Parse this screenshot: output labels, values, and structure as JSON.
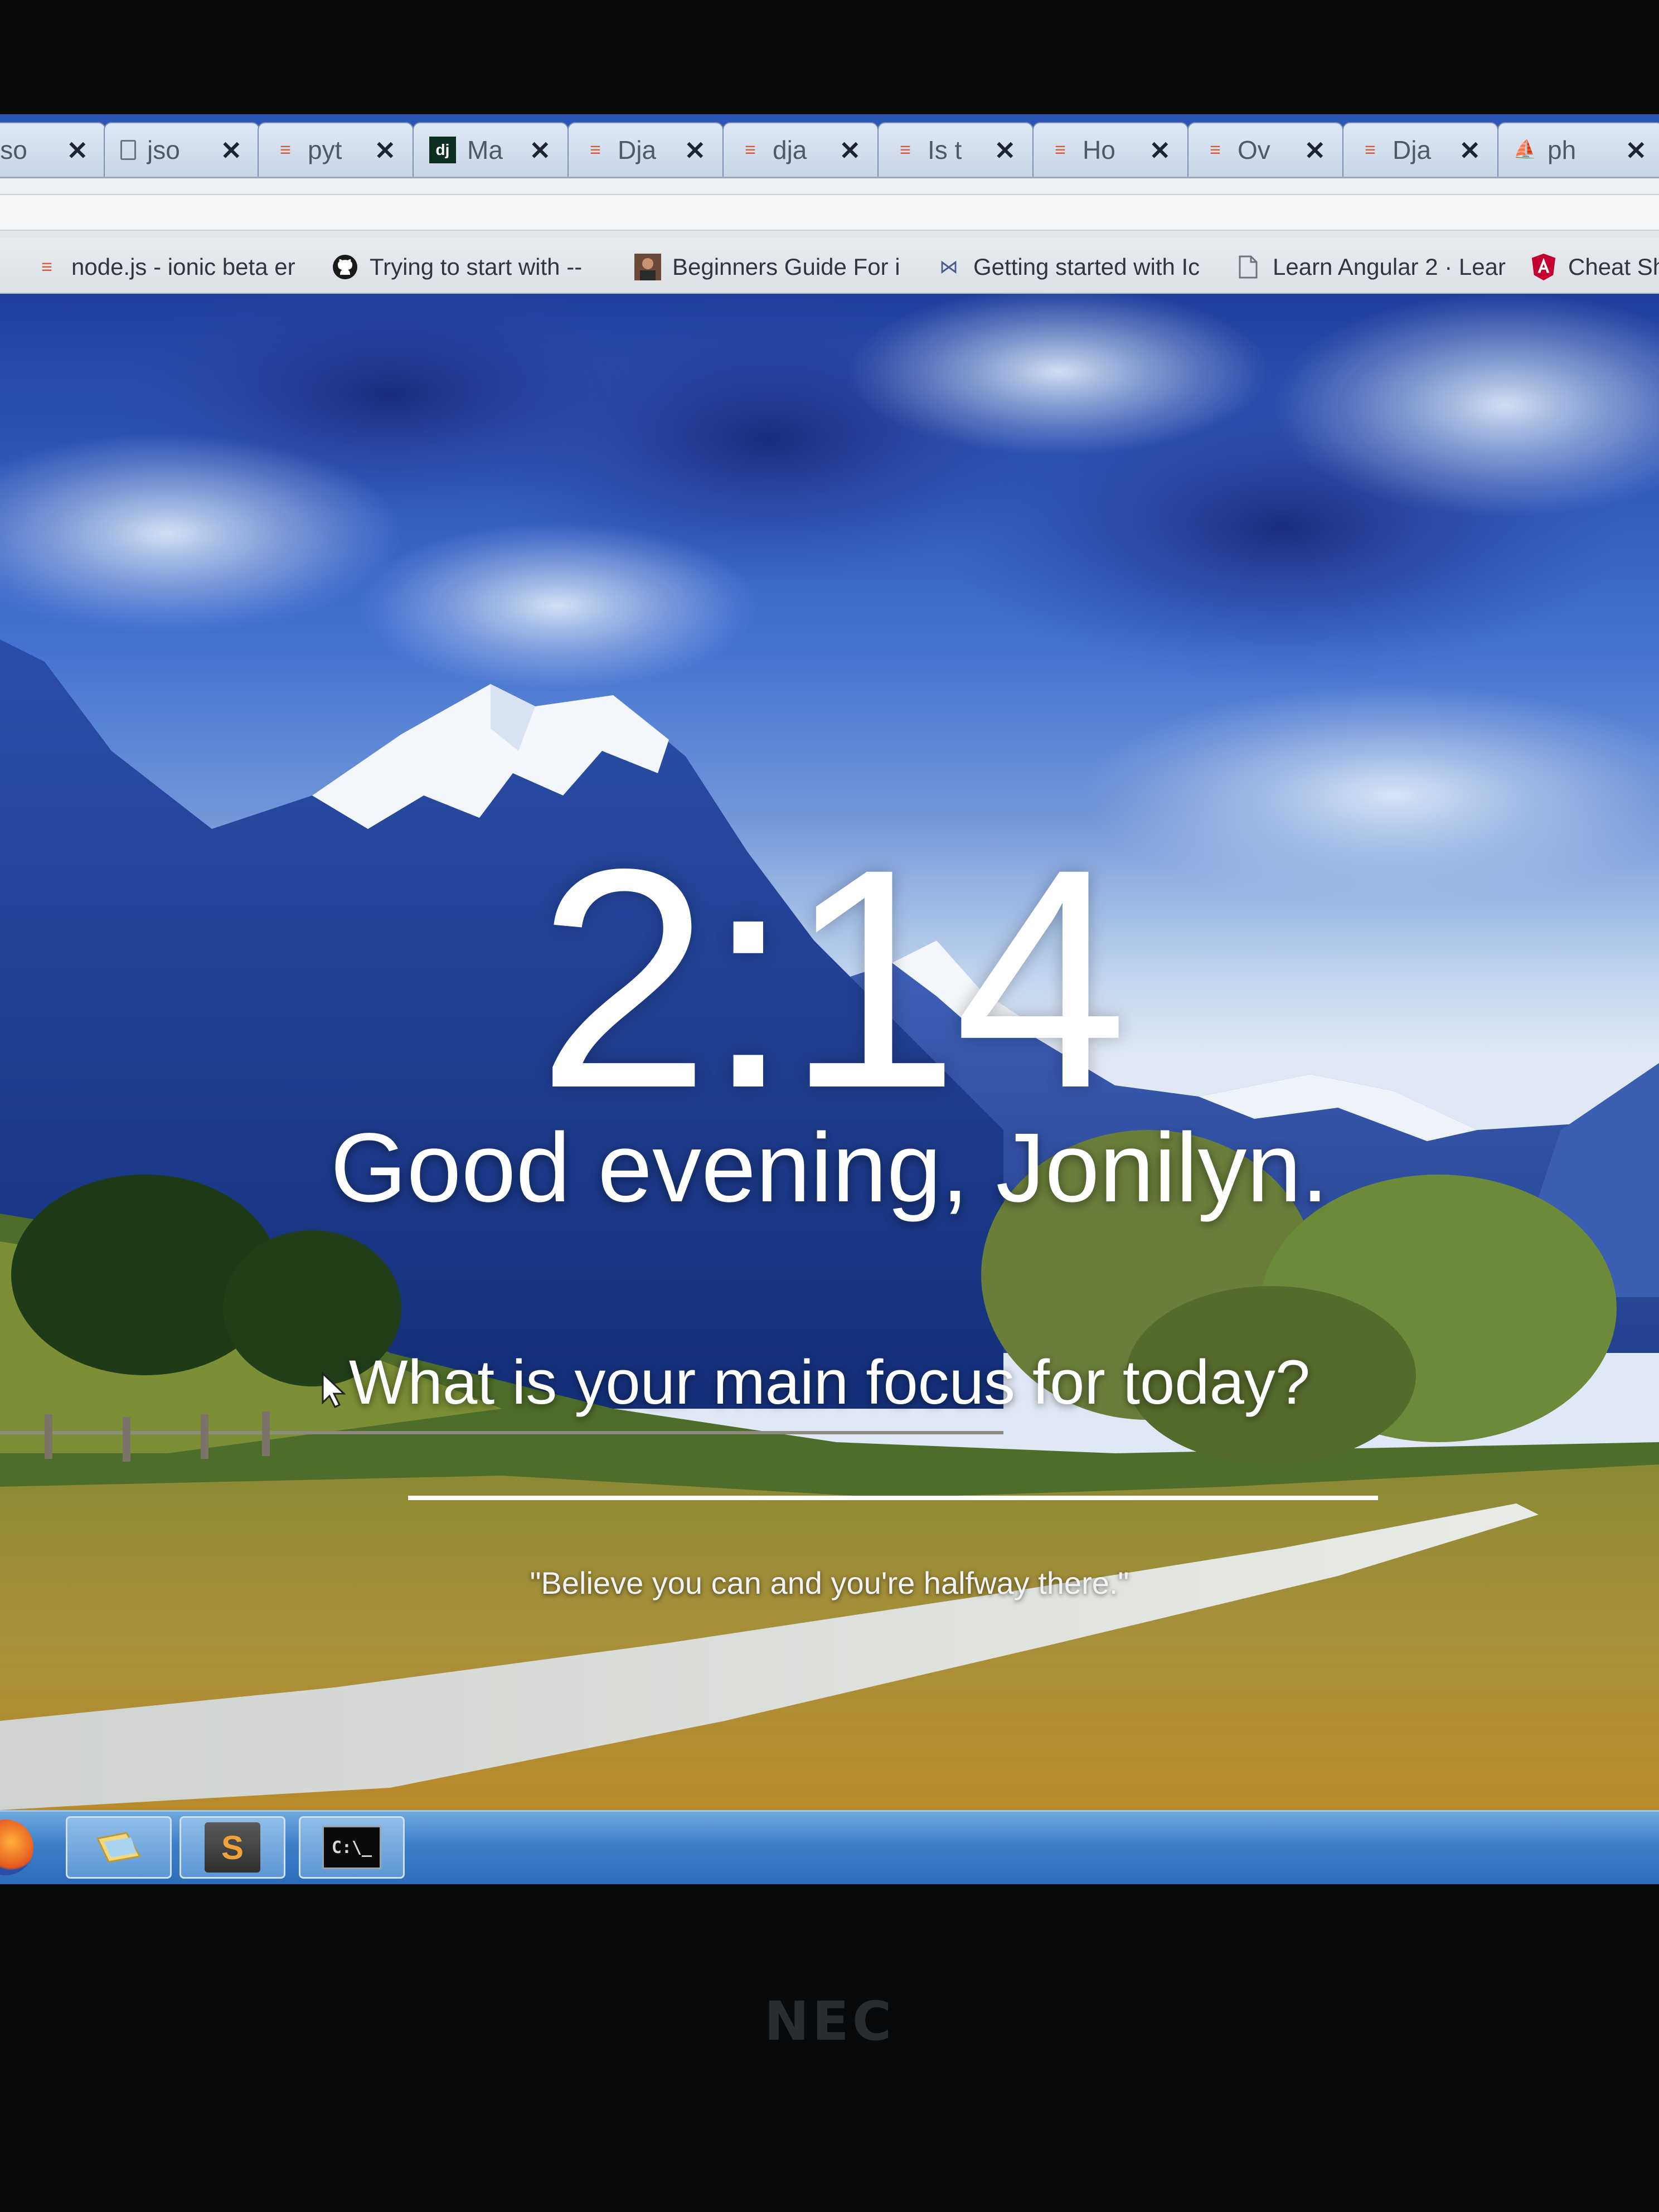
{
  "browser": {
    "tabs": [
      {
        "label": "jso",
        "icon": "none"
      },
      {
        "label": "jso",
        "icon": "document-icon"
      },
      {
        "label": "pyt",
        "icon": "stackoverflow-icon"
      },
      {
        "label": "Ma",
        "icon": "django-icon"
      },
      {
        "label": "Dja",
        "icon": "stackoverflow-icon"
      },
      {
        "label": "dja",
        "icon": "stackoverflow-icon"
      },
      {
        "label": "Is t",
        "icon": "stackoverflow-icon"
      },
      {
        "label": "Ho",
        "icon": "stackoverflow-icon"
      },
      {
        "label": "Ov",
        "icon": "stackoverflow-icon"
      },
      {
        "label": "Dja",
        "icon": "stackoverflow-icon"
      },
      {
        "label": "ph",
        "icon": "phpmyadmin-icon"
      }
    ],
    "bookmarks": [
      {
        "label": "node.js - ionic beta er",
        "icon": "stackoverflow-icon"
      },
      {
        "label": "Trying to start with --",
        "icon": "github-icon"
      },
      {
        "label": "Beginners Guide For i",
        "icon": "avatar-icon"
      },
      {
        "label": "Getting started with Ic",
        "icon": "visual-studio-icon"
      },
      {
        "label": "Learn Angular 2 · Lear",
        "icon": "document-icon"
      },
      {
        "label": "Cheat Sh",
        "icon": "angular-icon"
      }
    ]
  },
  "momentum": {
    "time": "2:14",
    "greeting": "Good evening, Jonilyn.",
    "focus_question": "What is your main focus for today?",
    "focus_value": "",
    "quote": "\"Believe you can and you're halfway there.\""
  },
  "taskbar": {
    "apps": [
      {
        "name": "firefox-icon"
      },
      {
        "name": "windows-explorer-icon"
      },
      {
        "name": "sublime-text-icon",
        "glyph": "S"
      },
      {
        "name": "command-prompt-icon",
        "glyph": "C:\\_"
      }
    ]
  },
  "monitor": {
    "brand": "NEC"
  },
  "colors": {
    "tab_bar": "#2b57b8",
    "stackoverflow": "#d35a3a",
    "taskbar": "#3e7fc8",
    "angular": "#c3002f"
  }
}
